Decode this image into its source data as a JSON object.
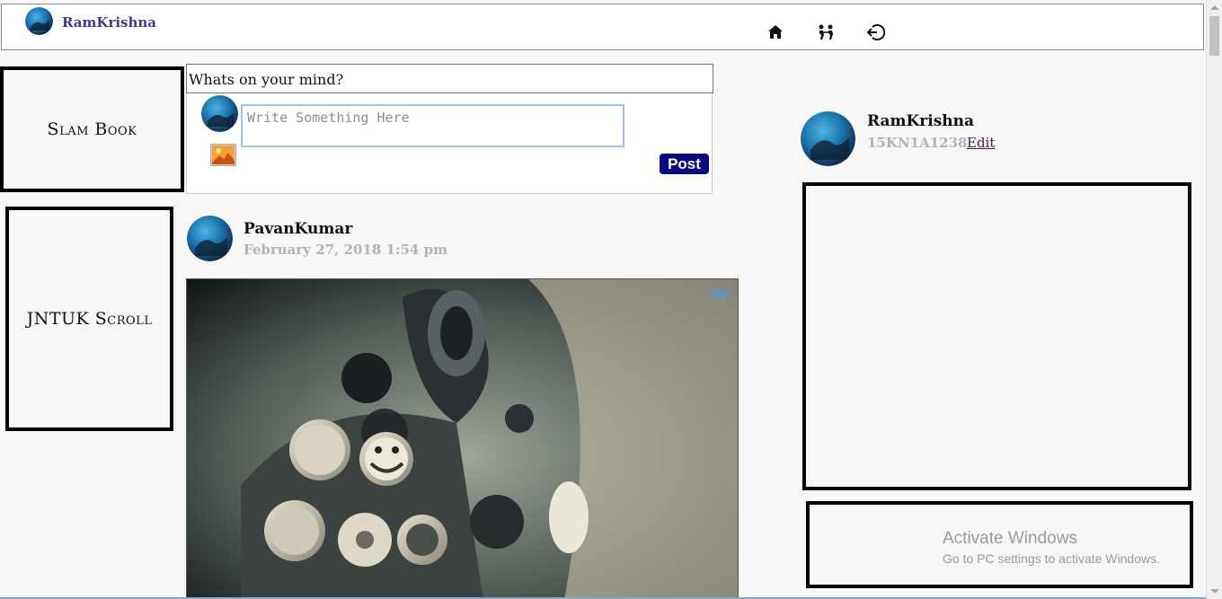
{
  "app": {
    "user_name": "RamKrishna"
  },
  "nav": {
    "icons": [
      "home-icon",
      "people-icon",
      "logout-icon"
    ]
  },
  "sidebar": {
    "slam_book": "Slam Book",
    "jntuk_scroll": "JNTUK Scroll"
  },
  "composer": {
    "title": "Whats on your mind?",
    "placeholder": "Write Something Here",
    "value": "",
    "post_label": "Post"
  },
  "feed": {
    "posts": [
      {
        "author": "PavanKumar",
        "timestamp": "February 27, 2018 1:54 pm"
      }
    ]
  },
  "profile": {
    "name": "RamKrishna",
    "id": "15KN1A1238",
    "edit_label": "Edit"
  },
  "watermark": {
    "title": "Activate Windows",
    "subtitle": "Go to PC settings to activate Windows."
  },
  "colors": {
    "brand_name": "#3b3a8c",
    "post_button": "#0a0a7f",
    "muted_text": "#b3b3b3",
    "input_border": "#9ec3e6"
  }
}
